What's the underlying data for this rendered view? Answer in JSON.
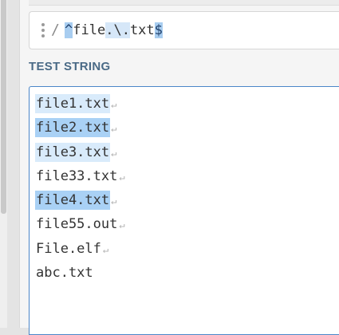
{
  "regex": {
    "delimiter": "/",
    "parts": [
      "^",
      "file",
      ".",
      "\\.",
      "txt",
      "$"
    ]
  },
  "test_string": {
    "label": "TEST STRING",
    "eol_symbol": "↵",
    "lines": [
      {
        "text": "file1.txt",
        "match": "a",
        "eol": true
      },
      {
        "text": "file2.txt",
        "match": "b",
        "eol": true
      },
      {
        "text": "file3.txt",
        "match": "a",
        "eol": true
      },
      {
        "text": "file33.txt",
        "match": "",
        "eol": true
      },
      {
        "text": "file4.txt",
        "match": "b",
        "eol": true
      },
      {
        "text": "file55.out",
        "match": "",
        "eol": true
      },
      {
        "text": "File.elf",
        "match": "",
        "eol": true
      },
      {
        "text": "abc.txt",
        "match": "",
        "eol": false
      }
    ]
  },
  "colors": {
    "match_light": "#d9ebfb",
    "match_dark": "#a9d1f5",
    "accent_border": "#4a86c8",
    "label_text": "#4a6a86"
  }
}
